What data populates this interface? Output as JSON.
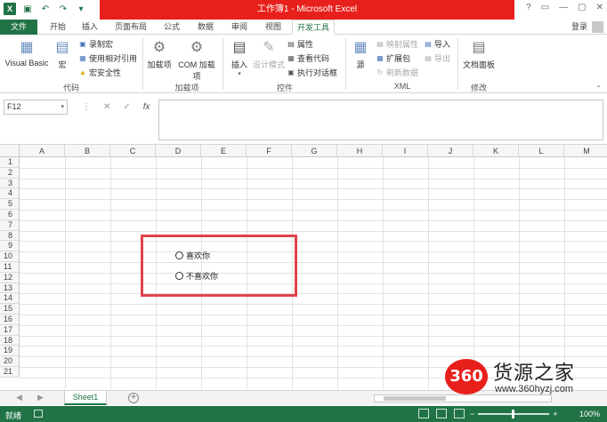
{
  "window": {
    "title": "工作簿1 - Microsoft Excel",
    "login": "登录",
    "controls": [
      "?",
      "▭",
      "—",
      "▢",
      "✕"
    ]
  },
  "tabs": [
    "文件",
    "开始",
    "插入",
    "页面布局",
    "公式",
    "数据",
    "审阅",
    "视图",
    "开发工具"
  ],
  "active_tab": "开发工具",
  "ribbon": {
    "code": {
      "label": "代码",
      "visual_basic": "Visual Basic",
      "macro": "宏",
      "record_macro": "录制宏",
      "relative_ref": "使用相对引用",
      "macro_security": "宏安全性"
    },
    "addins": {
      "label": "加载项",
      "addin": "加载项",
      "com_addin": "COM 加载项"
    },
    "controls": {
      "label": "控件",
      "insert": "插入",
      "design_mode": "设计模式",
      "properties": "属性",
      "view_code": "查看代码",
      "run_dialog": "执行对话框"
    },
    "xml": {
      "label": "XML",
      "source": "源",
      "map_props": "映射属性",
      "expansion": "扩展包",
      "refresh": "刷新数据",
      "import": "导入",
      "export": "导出"
    },
    "modify": {
      "label": "修改",
      "doc_panel": "文档面板"
    }
  },
  "formula_bar": {
    "name_box": "F12",
    "fx": "fx"
  },
  "columns": [
    "A",
    "B",
    "C",
    "D",
    "E",
    "F",
    "G",
    "H",
    "I",
    "J",
    "K",
    "L",
    "M"
  ],
  "rows": [
    "1",
    "2",
    "3",
    "4",
    "5",
    "6",
    "7",
    "8",
    "9",
    "10",
    "11",
    "12",
    "13",
    "14",
    "15",
    "16",
    "17",
    "18",
    "19",
    "20",
    "21"
  ],
  "radios": {
    "option1": "喜欢你",
    "option2": "不喜欢你"
  },
  "sheets": [
    "Sheet1"
  ],
  "status": {
    "ready": "就绪",
    "zoom": "100%"
  },
  "watermark": {
    "badge": "360",
    "text": "货源之家",
    "url": "www.360hyzj.com"
  },
  "colors": {
    "excel_green": "#217346",
    "title_red": "#e8201c",
    "highlight": "#e0424a"
  }
}
